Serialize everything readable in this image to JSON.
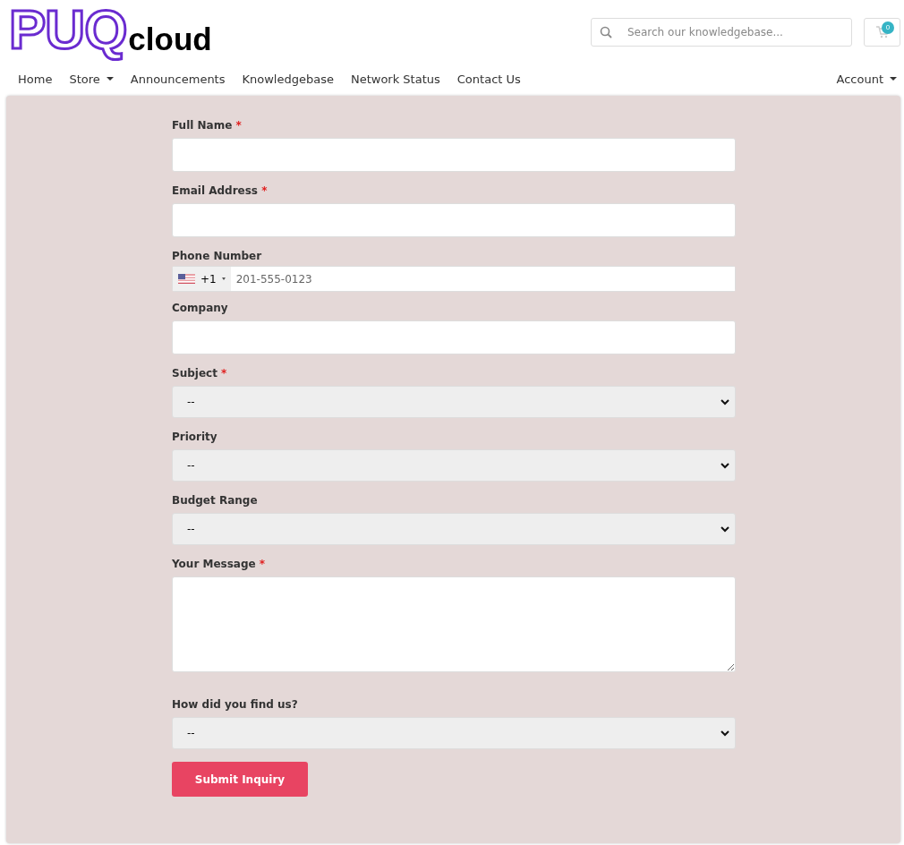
{
  "logo": {
    "mark": "PUQ",
    "word": "cloud"
  },
  "search": {
    "placeholder": "Search our knowledgebase..."
  },
  "cart": {
    "count": "0"
  },
  "nav": [
    {
      "label": "Home",
      "dropdown": false
    },
    {
      "label": "Store",
      "dropdown": true
    },
    {
      "label": "Announcements",
      "dropdown": false
    },
    {
      "label": "Knowledgebase",
      "dropdown": false
    },
    {
      "label": "Network Status",
      "dropdown": false
    },
    {
      "label": "Contact Us",
      "dropdown": false
    }
  ],
  "account": {
    "label": "Account",
    "dropdown": true
  },
  "fields": [
    {
      "kind": "text",
      "label": "Full Name",
      "required": true
    },
    {
      "kind": "text",
      "label": "Email Address",
      "required": true
    },
    {
      "kind": "phone",
      "label": "Phone Number",
      "required": false,
      "code": "+1",
      "placeholder": "201-555-0123"
    },
    {
      "kind": "text",
      "label": "Company",
      "required": false
    },
    {
      "kind": "select",
      "label": "Subject",
      "required": true,
      "value": "--"
    },
    {
      "kind": "select",
      "label": "Priority",
      "required": false,
      "value": "--"
    },
    {
      "kind": "select",
      "label": "Budget Range",
      "required": false,
      "value": "--"
    },
    {
      "kind": "textarea",
      "label": "Your Message",
      "required": true
    },
    {
      "kind": "select",
      "label": "How did you find us?",
      "required": false,
      "value": "--"
    }
  ],
  "required_mark": "*",
  "submit": "Submit Inquiry"
}
